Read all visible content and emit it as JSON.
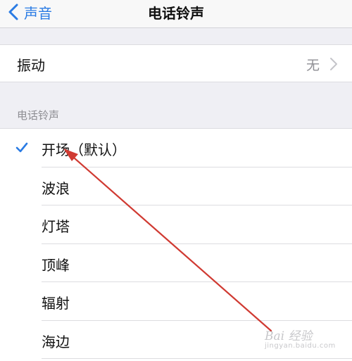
{
  "nav": {
    "back_label": "声音",
    "title": "电话铃声"
  },
  "vibration": {
    "label": "振动",
    "value": "无"
  },
  "ringtones": {
    "section_header": "电话铃声",
    "items": [
      {
        "label": "开场（默认）",
        "selected": true
      },
      {
        "label": "波浪",
        "selected": false
      },
      {
        "label": "灯塔",
        "selected": false
      },
      {
        "label": "顶峰",
        "selected": false
      },
      {
        "label": "辐射",
        "selected": false
      },
      {
        "label": "海边",
        "selected": false
      }
    ]
  },
  "watermark": {
    "brand": "Bai 经验",
    "sub": "jingyan.baidu.com"
  },
  "colors": {
    "accent": "#2a7be4",
    "annotation": "#d03a32",
    "background": "#efeff4"
  },
  "icons": {
    "back": "chevron-left-icon",
    "disclosure": "chevron-right-icon",
    "selected": "checkmark-icon"
  }
}
